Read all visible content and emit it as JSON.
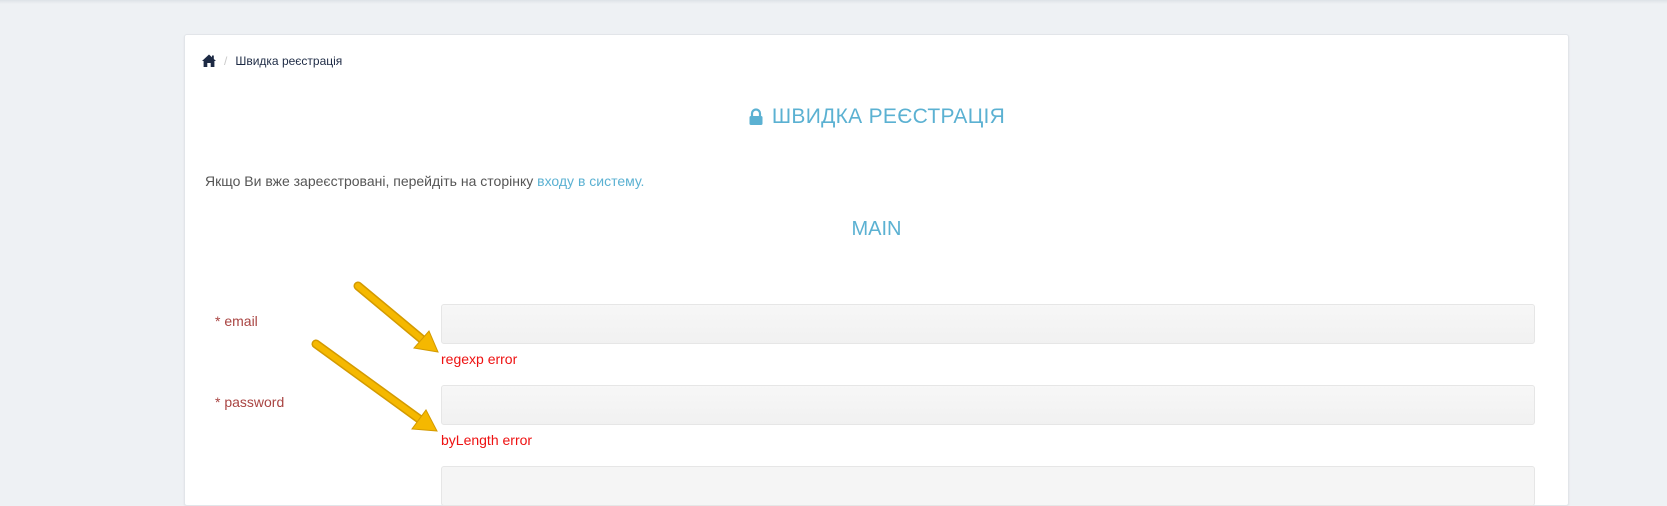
{
  "breadcrumb": {
    "home_icon": "home-icon",
    "separator": "/",
    "current": "Швидка реєстрація"
  },
  "header": {
    "icon": "lock-icon",
    "title": "ШВИДКА РЕЄСТРАЦІЯ"
  },
  "info": {
    "text": "Якщо Ви вже зареєстровані, перейдіть на сторінку ",
    "link_text": "входу в систему."
  },
  "section": {
    "title": "MAIN"
  },
  "form": {
    "fields": [
      {
        "label": "* email",
        "value": "",
        "error": "regexp error"
      },
      {
        "label": "* password",
        "value": "",
        "error": "byLength error"
      }
    ]
  },
  "annotations": {
    "arrow_color": "#f5b800"
  },
  "colors": {
    "accent": "#5bb1d2",
    "label": "#a94442",
    "error": "#ee1111"
  }
}
